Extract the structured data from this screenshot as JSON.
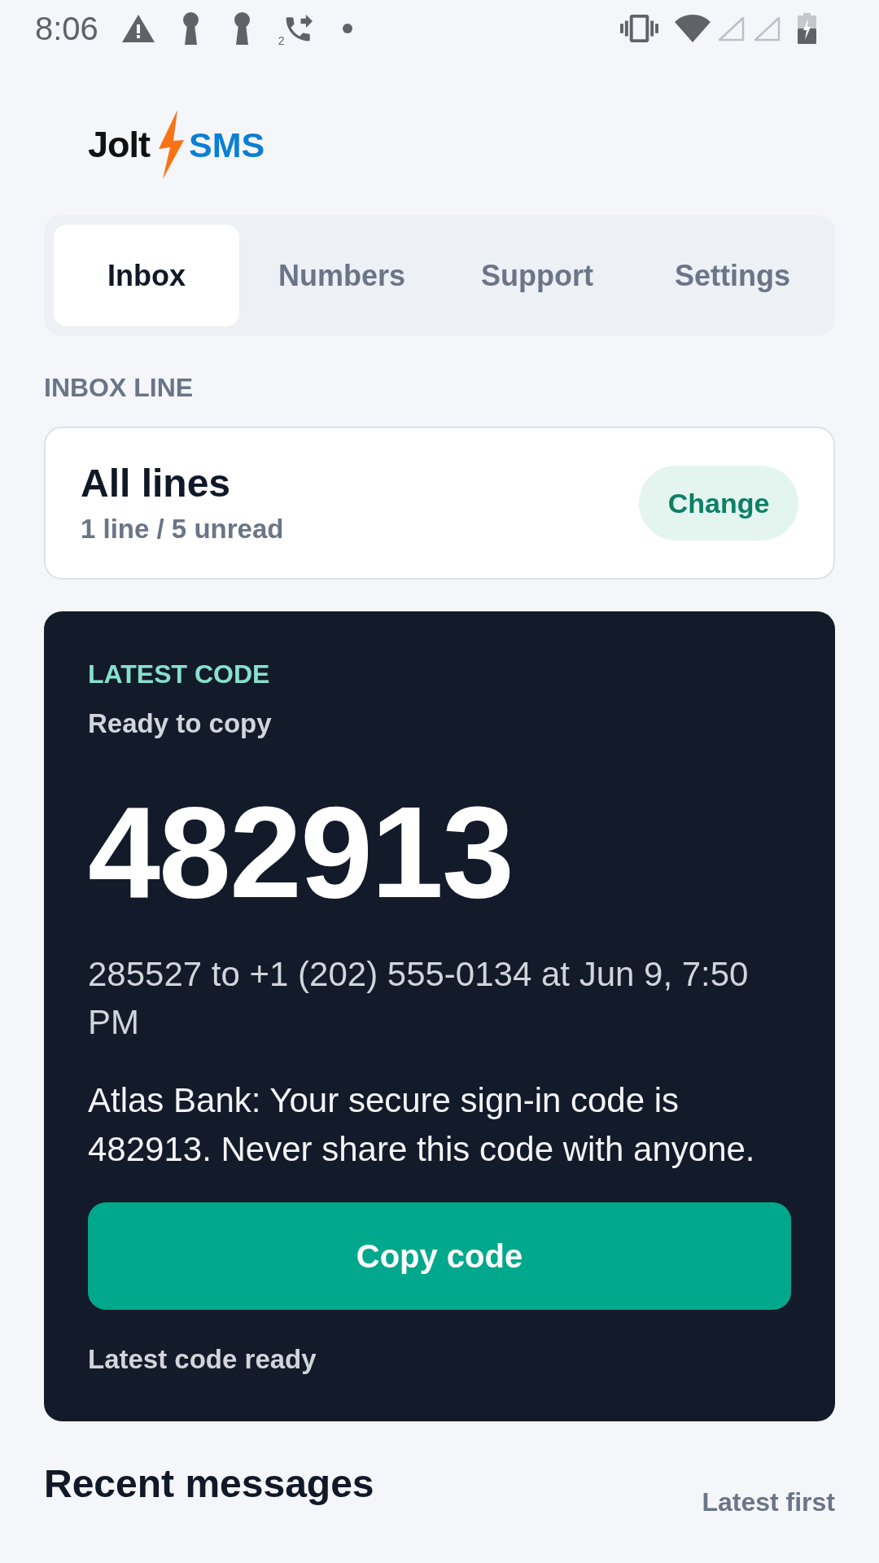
{
  "status_bar": {
    "time": "8:06",
    "forward_sim": "2"
  },
  "logo": {
    "brand": "Jolt",
    "product": "SMS"
  },
  "tabs": [
    {
      "label": "Inbox",
      "selected": true
    },
    {
      "label": "Numbers",
      "selected": false
    },
    {
      "label": "Support",
      "selected": false
    },
    {
      "label": "Settings",
      "selected": false
    }
  ],
  "inbox_line": {
    "label": "INBOX LINE",
    "title": "All lines",
    "summary": "1 line / 5 unread",
    "button": "Change"
  },
  "latest_code": {
    "label": "LATEST CODE",
    "status": "Ready to copy",
    "code": "482913",
    "meta": "285527 to +1 (202) 555-0134 at Jun 9, 7:50 PM",
    "message": "Atlas Bank: Your secure sign-in code is 482913. Never share this code with anyone.",
    "button": "Copy code",
    "footer": "Latest code ready"
  },
  "recent_messages": {
    "title": "Recent messages",
    "sort": "Latest first"
  }
}
